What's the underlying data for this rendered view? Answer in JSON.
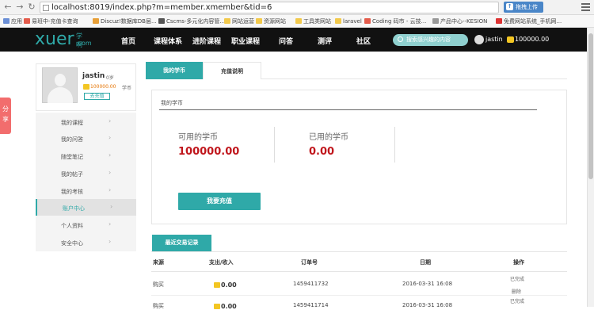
{
  "browser": {
    "url": "localhost:8019/index.php?m=member.xmember&tid=6",
    "ext_sync_label": "拖拽上传",
    "bookmarks": [
      {
        "label": "应用",
        "color": "#6b8fd6"
      },
      {
        "label": "易班中-充值卡查询",
        "color": "#e45c4c"
      },
      {
        "label": "Discuz!数据库DB层...",
        "color": "#e8a038"
      },
      {
        "label": "Cscms-多元化内容管...",
        "color": "#555555"
      },
      {
        "label": "网站运营",
        "color": "#f2c94c"
      },
      {
        "label": "资源网站",
        "color": "#f2c94c"
      },
      {
        "label": "工具类网站",
        "color": "#f2c94c"
      },
      {
        "label": "laravel",
        "color": "#f2c94c"
      },
      {
        "label": "Coding 码市 - 云技...",
        "color": "#e45c4c"
      },
      {
        "label": "产品中心--KESION",
        "color": "#999999"
      },
      {
        "label": "免费网站系统_手机网...",
        "color": "#d33"
      }
    ]
  },
  "site": {
    "logo_main": "xuer",
    "logo_cn": "学啊",
    "logo_com": ".com",
    "nav": [
      "首页",
      "课程体系",
      "进阶课程",
      "职业课程",
      "问答",
      "测评",
      "社区"
    ],
    "search_placeholder": "搜索感兴趣的内容",
    "username": "jastin",
    "coin_balance": "100000.00"
  },
  "share_tab": "分享",
  "profile": {
    "name": "jastin",
    "age": "0岁",
    "coins": "100000.00",
    "coin_unit": "学币",
    "button": "去充值"
  },
  "side_menu": [
    {
      "label": "我的课程",
      "active": false
    },
    {
      "label": "我的问答",
      "active": false
    },
    {
      "label": "随堂笔记",
      "active": false
    },
    {
      "label": "我的帖子",
      "active": false
    },
    {
      "label": "我的考核",
      "active": false
    },
    {
      "label": "账户中心",
      "active": true
    },
    {
      "label": "个人资料",
      "active": false
    },
    {
      "label": "安全中心",
      "active": false
    }
  ],
  "tabs": {
    "coins": "我的学币",
    "recharge_info": "充值说明"
  },
  "panel": {
    "title": "我的学币",
    "available_label": "可用的学币",
    "available_value": "100000.00",
    "used_label": "已用的学币",
    "used_value": "0.00",
    "recharge_button": "我要充值"
  },
  "records": {
    "tab": "最近交易记录",
    "headers": [
      "来源",
      "支出/收入",
      "订单号",
      "日期",
      "操作"
    ],
    "rows": [
      {
        "source": "购买",
        "amount": "0.00",
        "order": "1459411732",
        "date": "2016-03-31 16:08",
        "ops": [
          "已完成",
          "删除"
        ]
      },
      {
        "source": "购买",
        "amount": "0.00",
        "order": "1459411714",
        "date": "2016-03-31 16:08",
        "ops": [
          "已完成"
        ]
      }
    ]
  }
}
